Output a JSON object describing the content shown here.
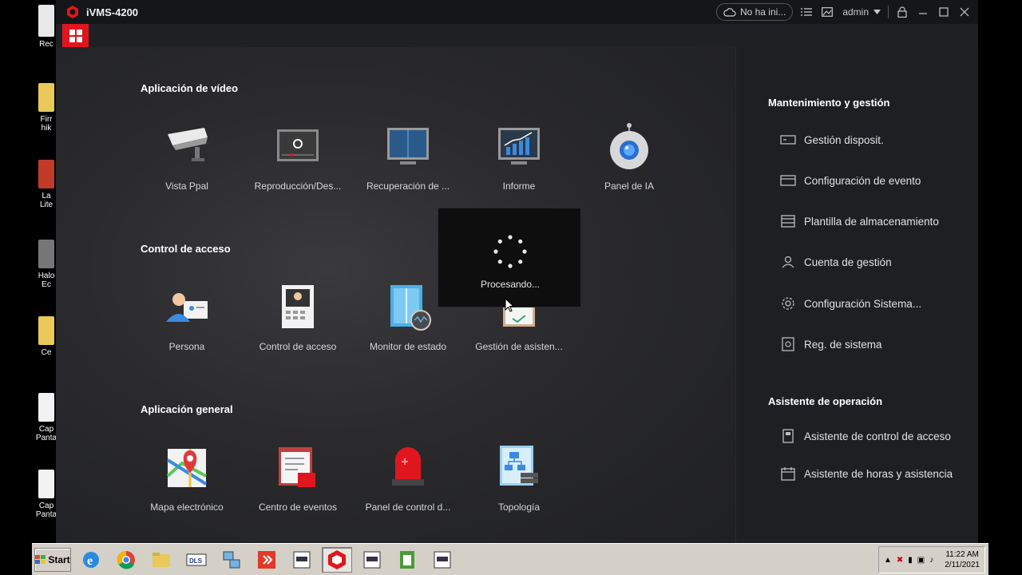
{
  "app": {
    "title": "iVMS-4200"
  },
  "titlebar": {
    "cloud_status": "No ha ini...",
    "user": "admin"
  },
  "desktop_icons": [
    "Rec",
    "Firr hik",
    "La Lite",
    "Halo Ec",
    "Ce",
    "Cap Panta",
    "Cap Panta"
  ],
  "sections": {
    "video": {
      "title": "Aplicación de vídeo",
      "tiles": [
        "Vista Ppal",
        "Reproducción/Des...",
        "Recuperación de ...",
        "Informe",
        "Panel de IA"
      ]
    },
    "access": {
      "title": "Control de acceso",
      "tiles": [
        "Persona",
        "Control de acceso",
        "Monitor de estado",
        "Gestión de asisten..."
      ]
    },
    "general": {
      "title": "Aplicación general",
      "tiles": [
        "Mapa electrónico",
        "Centro de eventos",
        "Panel de control d...",
        "Topología"
      ]
    }
  },
  "right_panel": {
    "maintenance_title": "Mantenimiento y gestión",
    "maintenance_items": [
      "Gestión disposit.",
      "Configuración de evento",
      "Plantilla de almacenamiento",
      "Cuenta de gestión",
      "Configuración Sistema...",
      "Reg. de sistema"
    ],
    "wizard_title": "Asistente de operación",
    "wizard_items": [
      "Asistente de control de acceso",
      "Asistente de horas y asistencia"
    ]
  },
  "processing": {
    "text": "Procesando..."
  },
  "taskbar": {
    "start_label": "Start",
    "time": "11:22 AM",
    "date": "2/11/2021"
  },
  "colors": {
    "accent": "#e0161f",
    "window_bg": "#1f2023",
    "panel_bg": "#1e1f22",
    "taskbar": "#d4d0c8"
  }
}
